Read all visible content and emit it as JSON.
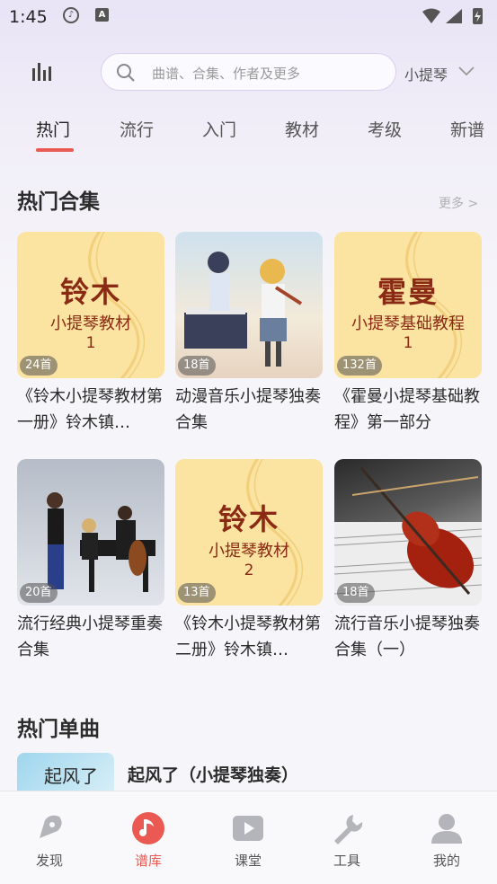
{
  "status_bar": {
    "time": "1:45",
    "icon1": "music-note-icon",
    "icon2": "a-icon"
  },
  "header": {
    "search_placeholder": "曲谱、合集、作者及更多",
    "instrument": "小提琴"
  },
  "tabs": [
    {
      "label": "热门",
      "active": true
    },
    {
      "label": "流行"
    },
    {
      "label": "入门"
    },
    {
      "label": "教材"
    },
    {
      "label": "考级"
    },
    {
      "label": "新谱"
    }
  ],
  "collections": {
    "title": "热门合集",
    "more": "更多 >",
    "items": [
      {
        "count": "24首",
        "title": "《铃木小提琴教材第一册》铃木镇…",
        "cover_big": "铃木",
        "cover_sub": "小提琴教材",
        "cover_num": "1"
      },
      {
        "count": "18首",
        "title": "动漫音乐小提琴独奏合集"
      },
      {
        "count": "132首",
        "title": "《霍曼小提琴基础教程》第一部分",
        "cover_big": "霍曼",
        "cover_sub": "小提琴基础教程",
        "cover_num": "1"
      },
      {
        "count": "20首",
        "title": "流行经典小提琴重奏合集"
      },
      {
        "count": "13首",
        "title": "《铃木小提琴教材第二册》铃木镇…",
        "cover_big": "铃木",
        "cover_sub": "小提琴教材",
        "cover_num": "2"
      },
      {
        "count": "18首",
        "title": "流行音乐小提琴独奏合集（一）"
      }
    ]
  },
  "singles": {
    "title": "热门单曲",
    "items": [
      {
        "title": "起风了（小提琴独奏）",
        "thumb_text": "起风了"
      }
    ]
  },
  "bottom_nav": [
    {
      "label": "发现",
      "icon": "compass-icon"
    },
    {
      "label": "谱库",
      "icon": "music-note-icon",
      "active": true
    },
    {
      "label": "课堂",
      "icon": "play-icon"
    },
    {
      "label": "工具",
      "icon": "wrench-icon"
    },
    {
      "label": "我的",
      "icon": "user-icon"
    }
  ],
  "colors": {
    "accent": "#ea5a52",
    "book_bg": "#fbe3a1",
    "book_text": "#8a2a14"
  }
}
